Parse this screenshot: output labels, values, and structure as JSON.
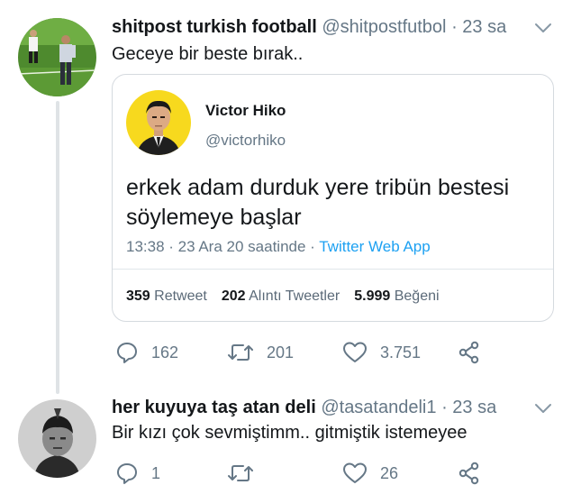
{
  "tweet1": {
    "name": "shitpost turkish football",
    "handle": "@shitpostfutbol",
    "time": "· 23 sa",
    "text": "Geceye bir beste bırak..",
    "quote": {
      "name": "Victor Hiko",
      "handle": "@victorhiko",
      "text_line1": "erkek adam durduk yere tribün bestesi",
      "text_line2": "söylemeye başlar",
      "time": "13:38 · 23 Ara 20 saatinde · ",
      "app": "Twitter Web App",
      "retweets": "359",
      "retweets_label": "Retweet",
      "quotes": "202",
      "quotes_label": "Alıntı Tweetler",
      "likes": "5.999",
      "likes_label": "Beğeni"
    },
    "actions": {
      "replies": "162",
      "retweets": "201",
      "likes": "3.751"
    }
  },
  "tweet2": {
    "name": "her kuyuya taş atan deli",
    "handle": "@tasatandeli1",
    "time": "· 23 sa",
    "text": "Bir kızı çok sevmiştimm.. gitmiştik istemeyee",
    "actions": {
      "replies": "1",
      "retweets": "",
      "likes": "26"
    }
  },
  "colors": {
    "text": "#14171a",
    "secondary": "#657786",
    "accent": "#1da1f2",
    "border": "#d5dadf",
    "avatar_yellow": "#f7d91e"
  },
  "icons": [
    "chevron-down-icon",
    "reply-icon",
    "retweet-icon",
    "like-icon",
    "share-icon"
  ]
}
